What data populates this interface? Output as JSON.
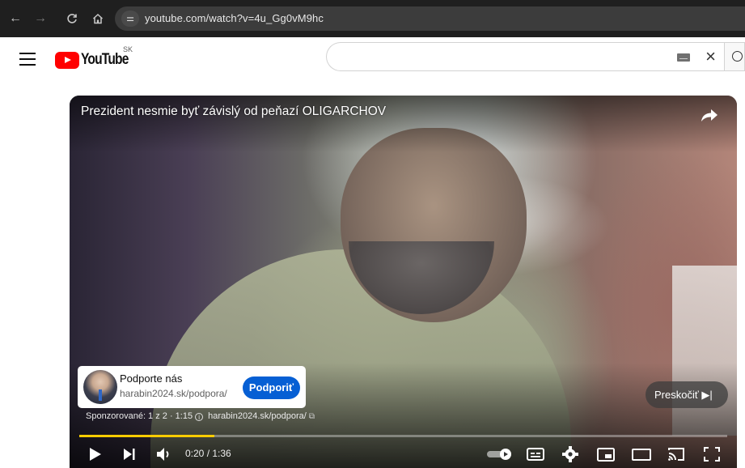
{
  "browser": {
    "url": "youtube.com/watch?v=4u_Gg0vM9hc",
    "back_icon": "←",
    "forward_icon": "→",
    "reload_icon": "C",
    "home_icon": "⌂",
    "site_info_icon": "⚌"
  },
  "header": {
    "logo_text": "YouTube",
    "country_code": "SK",
    "search_value": "",
    "clear_icon": "×"
  },
  "player": {
    "title": "Prezident nesmie byť závislý od peňazí OLIGARCHOV",
    "ad": {
      "title": "Podporte nás",
      "url": "harabin2024.sk/podpora/",
      "cta_label": "Podporiť",
      "sponsored_text": "Sponzorované: 1 z 2 · 1:15",
      "info_icon": "i",
      "meta_link": "harabin2024.sk/podpora/",
      "external_icon": "⧉"
    },
    "skip_label": "Preskočiť ▶|",
    "time_current": "0:20",
    "time_sep": " / ",
    "time_total": "1:36",
    "progress_fraction": 0.208,
    "accent_color": "#ffcc00",
    "cta_color": "#065fd4"
  }
}
